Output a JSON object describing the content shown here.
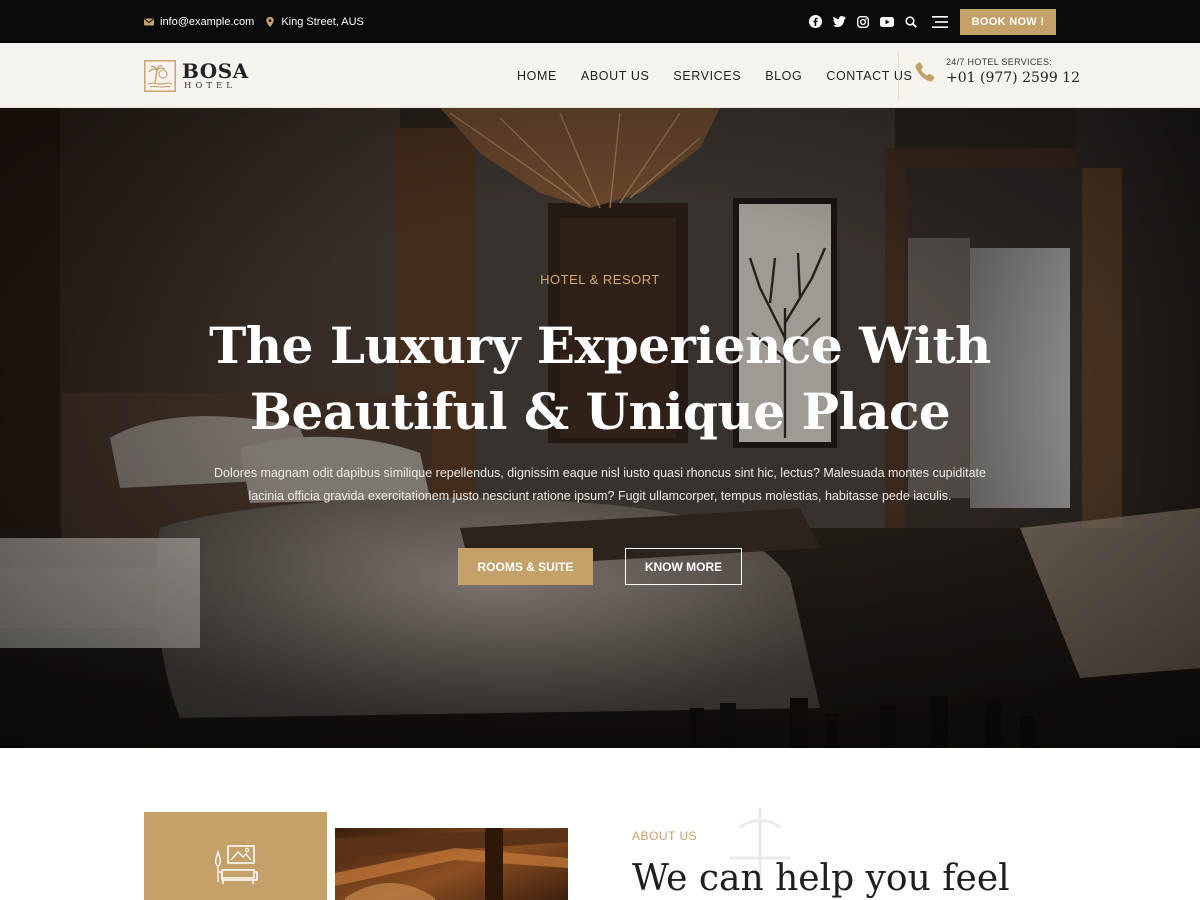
{
  "topbar": {
    "email": "info@example.com",
    "address": "King Street, AUS",
    "social": [
      "facebook-icon",
      "twitter-icon",
      "instagram-icon",
      "youtube-icon"
    ],
    "book_label": "BOOK NOW !"
  },
  "header": {
    "logo": {
      "brand": "BOSA",
      "sub": "HOTEL"
    },
    "nav": [
      "HOME",
      "ABOUT US",
      "SERVICES",
      "BLOG",
      "CONTACT US"
    ],
    "phone_label": "24/7 HOTEL SERVICES:",
    "phone_number": "+01 (977) 2599 12"
  },
  "hero": {
    "kicker": "HOTEL & RESORT",
    "title_line1": "The Luxury Experience With",
    "title_line2": "Beautiful & Unique Place",
    "desc_line1": "Dolores magnam odit dapibus similique repellendus, dignissim eaque nisl iusto quasi rhoncus sint hic, lectus? Malesuada montes cupiditate",
    "desc_line2": "lacinia officia gravida exercitationem justo nesciunt ratione ipsum? Fugit ullamcorper, tempus molestias, habitasse pede iaculis.",
    "primary_button": "ROOMS & SUITE",
    "secondary_button": "KNOW MORE"
  },
  "about": {
    "kicker": "ABOUT US",
    "heading": "We can help you feel"
  },
  "colors": {
    "accent": "#c5a16a",
    "topbar_bg": "#0a0a0a",
    "header_bg": "#f6f3ee"
  }
}
